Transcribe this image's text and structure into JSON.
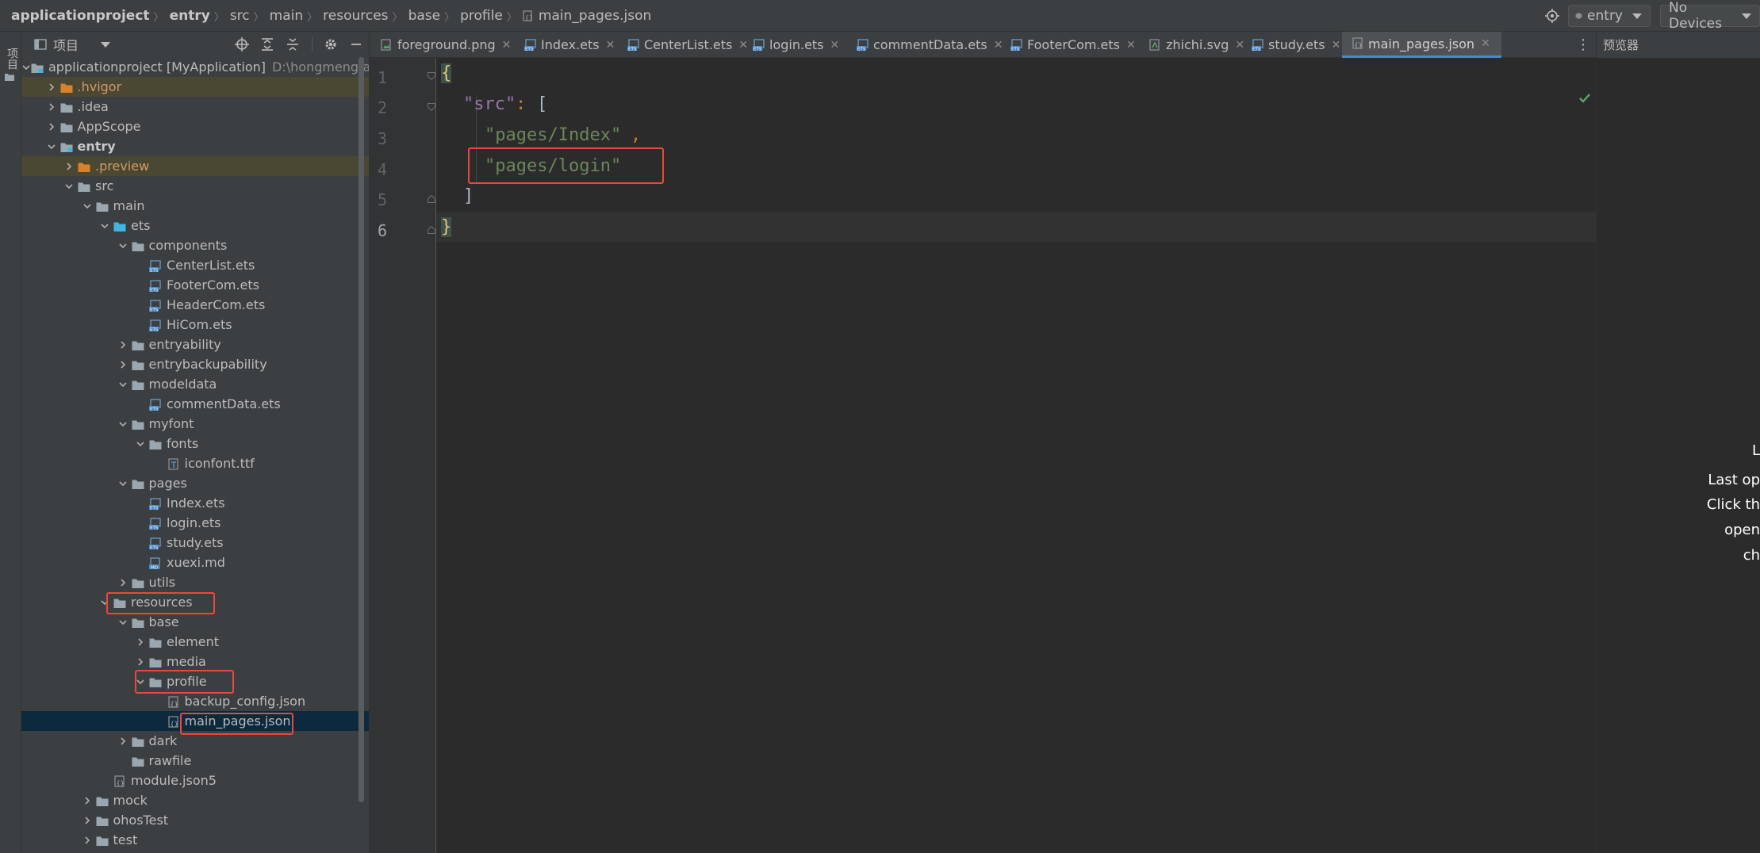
{
  "breadcrumb": {
    "items": [
      "applicationproject",
      "entry",
      "src",
      "main",
      "resources",
      "base",
      "profile",
      "main_pages.json"
    ]
  },
  "toolbar": {
    "module_select": "entry",
    "device_select": "No Devices"
  },
  "left_strip": {
    "label": "项目"
  },
  "project_panel": {
    "title": "项目",
    "tree": [
      {
        "label": "applicationproject [MyApplication]",
        "sub": "D:\\hongmeng\\ap",
        "bold_prefix": true
      },
      {
        "label": ".hvigor"
      },
      {
        "label": ".idea"
      },
      {
        "label": "AppScope"
      },
      {
        "label": "entry"
      },
      {
        "label": ".preview"
      },
      {
        "label": "src"
      },
      {
        "label": "main"
      },
      {
        "label": "ets"
      },
      {
        "label": "components"
      },
      {
        "label": "CenterList.ets"
      },
      {
        "label": "FooterCom.ets"
      },
      {
        "label": "HeaderCom.ets"
      },
      {
        "label": "HiCom.ets"
      },
      {
        "label": "entryability"
      },
      {
        "label": "entrybackupability"
      },
      {
        "label": "modeldata"
      },
      {
        "label": "commentData.ets"
      },
      {
        "label": "myfont"
      },
      {
        "label": "fonts"
      },
      {
        "label": "iconfont.ttf"
      },
      {
        "label": "pages"
      },
      {
        "label": "Index.ets"
      },
      {
        "label": "login.ets"
      },
      {
        "label": "study.ets"
      },
      {
        "label": "xuexi.md"
      },
      {
        "label": "utils"
      },
      {
        "label": "resources"
      },
      {
        "label": "base"
      },
      {
        "label": "element"
      },
      {
        "label": "media"
      },
      {
        "label": "profile"
      },
      {
        "label": "backup_config.json"
      },
      {
        "label": "main_pages.json"
      },
      {
        "label": "dark"
      },
      {
        "label": "rawfile"
      },
      {
        "label": "module.json5"
      },
      {
        "label": "mock"
      },
      {
        "label": "ohosTest"
      },
      {
        "label": "test"
      }
    ]
  },
  "editor": {
    "tabs": [
      "foreground.png",
      "Index.ets",
      "CenterList.ets",
      "login.ets",
      "commentData.ets",
      "FooterCom.ets",
      "zhichi.svg",
      "study.ets",
      "main_pages.json"
    ],
    "active_tab": "main_pages.json",
    "line_numbers": [
      "1",
      "2",
      "3",
      "4",
      "5",
      "6"
    ],
    "code": {
      "l1_brace": "{",
      "l2_key": "\"src\"",
      "l2_colon": ": ",
      "l2_bracket": "[",
      "l3_str": "\"pages/Index\"",
      "l3_comma": ",",
      "l4_str": "\"pages/login\"",
      "l5_bracket": "]",
      "l6_brace": "}"
    }
  },
  "preview_panel": {
    "title": "预览器",
    "lines": [
      "L",
      "Last op",
      "Click th",
      "open",
      "ch"
    ]
  },
  "colors": {
    "highlight_box": "#e8483d",
    "active_tab_underline": "#4a88c7",
    "selected_row": "#0d293e"
  }
}
